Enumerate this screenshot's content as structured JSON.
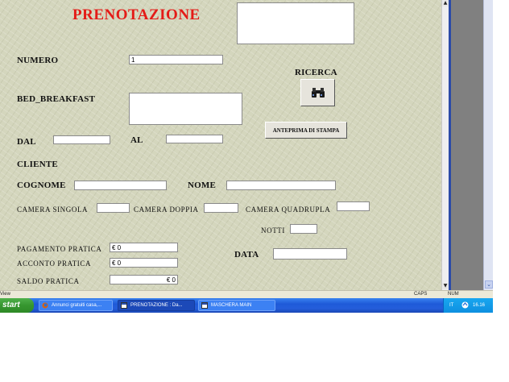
{
  "form": {
    "title": "PRENOTAZIONE",
    "labels": {
      "numero": "NUMERO",
      "bed_breakfast": "BED_BREAKFAST",
      "ricerca": "RICERCA",
      "dal": "DAL",
      "al": "AL",
      "cliente": "CLIENTE",
      "cognome": "COGNOME",
      "nome": "NOME",
      "camera_singola": "CAMERA SINGOLA",
      "camera_doppia": "CAMERA DOPPIA",
      "camera_quadrupla": "CAMERA QUADRUPLA",
      "notti": "NOTTI",
      "pagamento_pratica": "PAGAMENTO PRATICA",
      "acconto_pratica": "ACCONTO PRATICA",
      "saldo_pratica": "SALDO PRATICA",
      "data": "DATA"
    },
    "values": {
      "numero": "1",
      "pagamento_pratica": "€ 0",
      "acconto_pratica": "€ 0",
      "saldo_pratica": "€ 0"
    },
    "buttons": {
      "ricerca_icon": "binoculars-icon",
      "anteprima": "ANTEPRIMA DI STAMPA"
    }
  },
  "statusbar": {
    "left": "View",
    "caps": "CAPS",
    "num": "NUM"
  },
  "taskbar": {
    "start": "start",
    "tasks": [
      {
        "label": "Annunci gratuiti casa,...",
        "icon": "firefox-icon"
      },
      {
        "label": "PRENOTAZIONE : Da...",
        "icon": "access-form-icon",
        "active": true
      },
      {
        "label": "MASCHERA MAIN",
        "icon": "access-form-icon"
      }
    ],
    "lang": "IT",
    "clock": "16.16"
  },
  "colors": {
    "title": "#e41b17",
    "form_bg": "#d4d6bd",
    "taskbar": "#245edb",
    "start": "#36962f"
  }
}
